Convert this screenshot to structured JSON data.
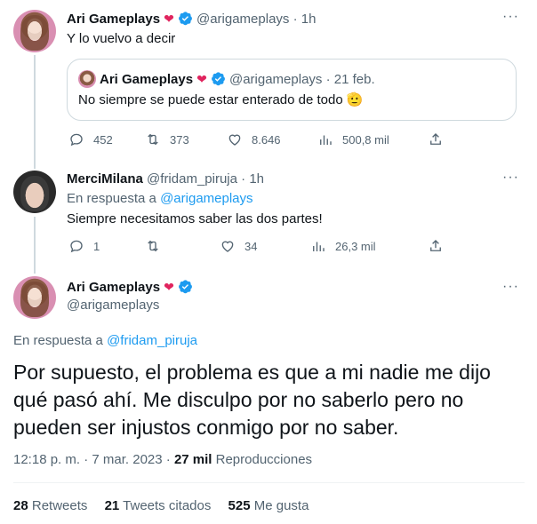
{
  "tweet1": {
    "name": "Ari Gameplays",
    "handle": "@arigameplays",
    "time": "1h",
    "text": "Y lo vuelvo a decir",
    "quote": {
      "name": "Ari Gameplays",
      "handle": "@arigameplays",
      "time": "21 feb.",
      "text": "No siempre se puede estar enterado de todo 🫡"
    },
    "actions": {
      "replies": "452",
      "retweets": "373",
      "likes": "8.646",
      "views": "500,8 mil"
    }
  },
  "tweet2": {
    "name": "MerciMilana",
    "handle": "@fridam_piruja",
    "time": "1h",
    "reply_prefix": "En respuesta a ",
    "reply_to": "@arigameplays",
    "text": "Siempre necesitamos saber las dos partes!",
    "actions": {
      "replies": "1",
      "retweets": "",
      "likes": "34",
      "views": "26,3 mil"
    }
  },
  "tweet3": {
    "name": "Ari Gameplays",
    "handle": "@arigameplays",
    "reply_prefix": "En respuesta a ",
    "reply_to": "@fridam_piruja",
    "text": "Por supuesto, el problema es que a mi nadie me dijo qué pasó ahí. Me disculpo por no saberlo pero no pueden ser injustos conmigo por no saber.",
    "timestamp": "12:18 p. m. · 7 mar. 2023 · ",
    "views_count": "27 mil",
    "views_label": " Reproducciones",
    "stats": {
      "retweets_count": "28",
      "retweets_label": " Retweets",
      "quotes_count": "21",
      "quotes_label": " Tweets citados",
      "likes_count": "525",
      "likes_label": " Me gusta"
    }
  },
  "separator": " · ",
  "more_label": "···",
  "heart_emoji": "❤",
  "colors": {
    "accent": "#1d9bf0",
    "heart": "#e0245e",
    "secondary_text": "#536471",
    "border": "#cfd9de"
  },
  "icons": [
    "reply-icon",
    "retweet-icon",
    "like-icon",
    "views-icon",
    "share-icon",
    "verified-badge-icon",
    "more-icon"
  ]
}
